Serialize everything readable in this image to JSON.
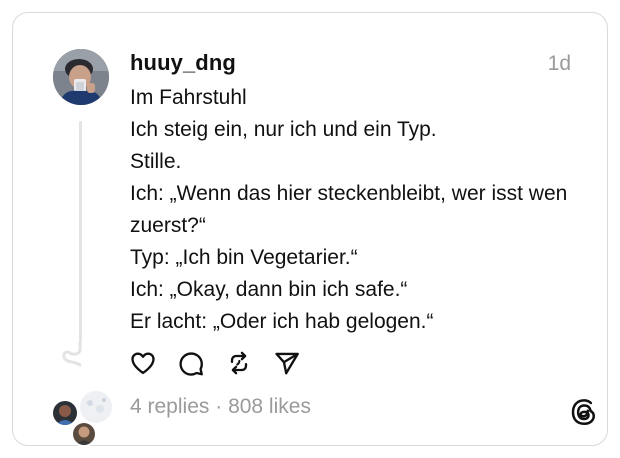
{
  "post": {
    "username": "huuy_dng",
    "timestamp": "1d",
    "lines": [
      "Im Fahrstuhl",
      "Ich steig ein, nur ich und ein Typ.",
      "Stille.",
      "Ich: „Wenn das hier steckenbleibt, wer isst wen",
      "zuerst?“",
      "Typ: „Ich bin Vegetarier.“",
      "Ich: „Okay, dann bin ich safe.“",
      "Er lacht: „Oder ich hab gelogen.“"
    ]
  },
  "actions": {
    "like_icon": "heart-icon",
    "reply_icon": "comment-icon",
    "repost_icon": "repost-icon",
    "share_icon": "send-icon"
  },
  "stats": {
    "replies": "4 replies",
    "separator": " · ",
    "likes": "808 likes"
  },
  "colors": {
    "text": "#111111",
    "muted": "#9a9a9a",
    "border": "#d9d9d9",
    "thread_line": "#e3e3e3"
  }
}
